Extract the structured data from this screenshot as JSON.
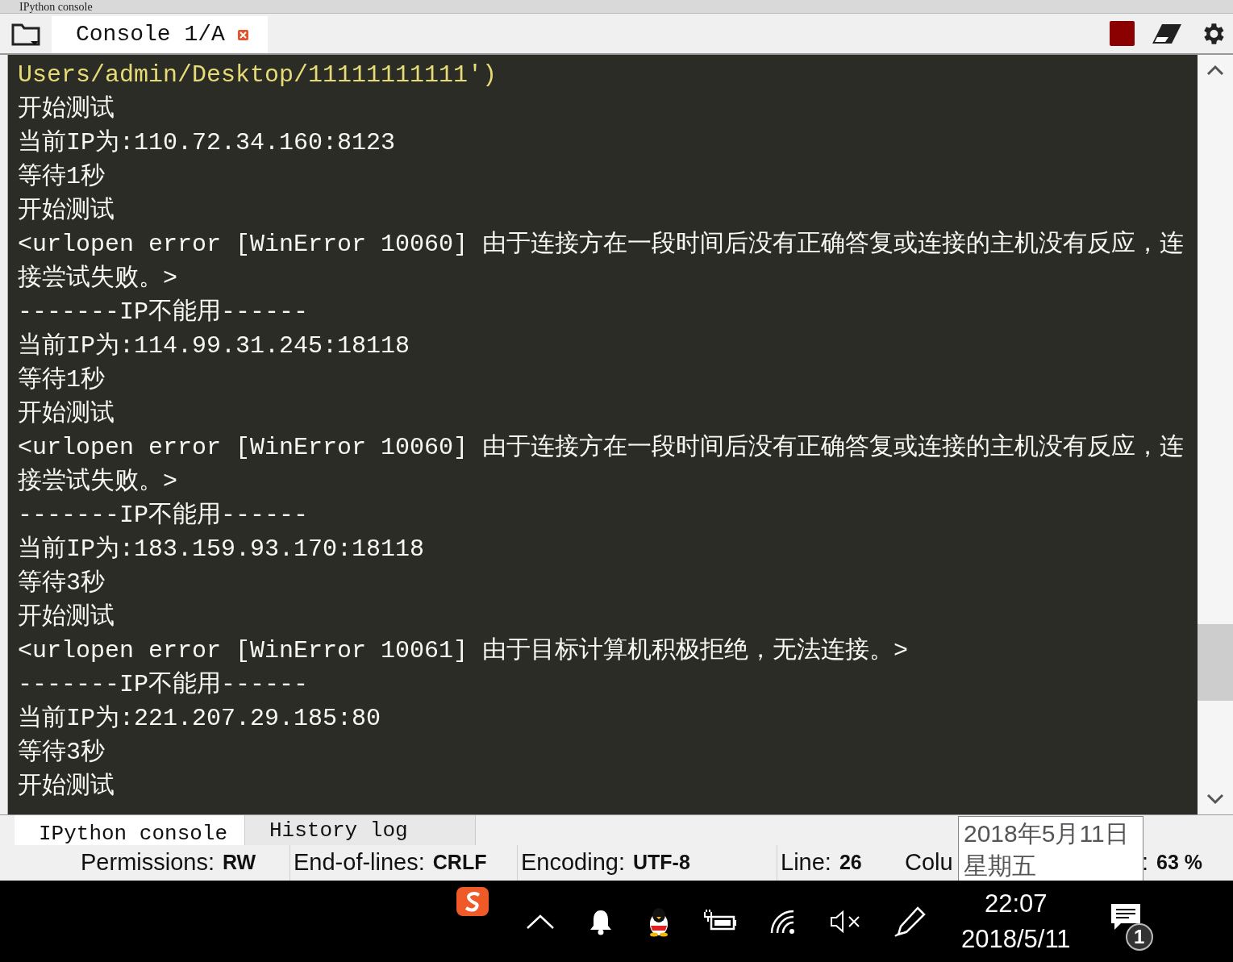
{
  "window": {
    "title": "IPython console"
  },
  "tabs": [
    {
      "label": "Console 1/A",
      "selected": true
    }
  ],
  "console": {
    "lines": [
      {
        "kind": "path",
        "text": "Users/admin/Desktop/11111111111')"
      },
      {
        "kind": "text",
        "text": "开始测试"
      },
      {
        "kind": "text",
        "text": "当前IP为:110.72.34.160:8123"
      },
      {
        "kind": "text",
        "text": "等待1秒"
      },
      {
        "kind": "text",
        "text": "开始测试"
      },
      {
        "kind": "text",
        "text": "<urlopen error [WinError 10060] 由于连接方在一段时间后没有正确答复或连接的主机没有反应，连接尝试失败。>"
      },
      {
        "kind": "text",
        "text": "-------IP不能用------"
      },
      {
        "kind": "text",
        "text": "当前IP为:114.99.31.245:18118"
      },
      {
        "kind": "text",
        "text": "等待1秒"
      },
      {
        "kind": "text",
        "text": "开始测试"
      },
      {
        "kind": "text",
        "text": "<urlopen error [WinError 10060] 由于连接方在一段时间后没有正确答复或连接的主机没有反应，连接尝试失败。>"
      },
      {
        "kind": "text",
        "text": "-------IP不能用------"
      },
      {
        "kind": "text",
        "text": "当前IP为:183.159.93.170:18118"
      },
      {
        "kind": "text",
        "text": "等待3秒"
      },
      {
        "kind": "text",
        "text": "开始测试"
      },
      {
        "kind": "text",
        "text": "<urlopen error [WinError 10061] 由于目标计算机积极拒绝，无法连接。>"
      },
      {
        "kind": "text",
        "text": "-------IP不能用------"
      },
      {
        "kind": "text",
        "text": "当前IP为:221.207.29.185:80"
      },
      {
        "kind": "text",
        "text": "等待3秒"
      },
      {
        "kind": "text",
        "text": "开始测试"
      }
    ]
  },
  "pane_tabs": [
    {
      "label": "IPython console",
      "selected": true
    },
    {
      "label": "History log",
      "selected": false
    }
  ],
  "status_bar": [
    {
      "label": "Permissions:",
      "value": "RW"
    },
    {
      "label": "End-of-lines:",
      "value": "CRLF"
    },
    {
      "label": "Encoding:",
      "value": "UTF-8"
    },
    {
      "label": "Line:",
      "value": "26"
    },
    {
      "label": "Colu"
    },
    {
      "label": ":",
      "value": "63 %"
    }
  ],
  "tooltip": {
    "lines": [
      "2018年5月11日",
      "星期五"
    ]
  },
  "taskbar": {
    "time": "22:07",
    "date": "2018/5/11",
    "notification_count": "1"
  }
}
